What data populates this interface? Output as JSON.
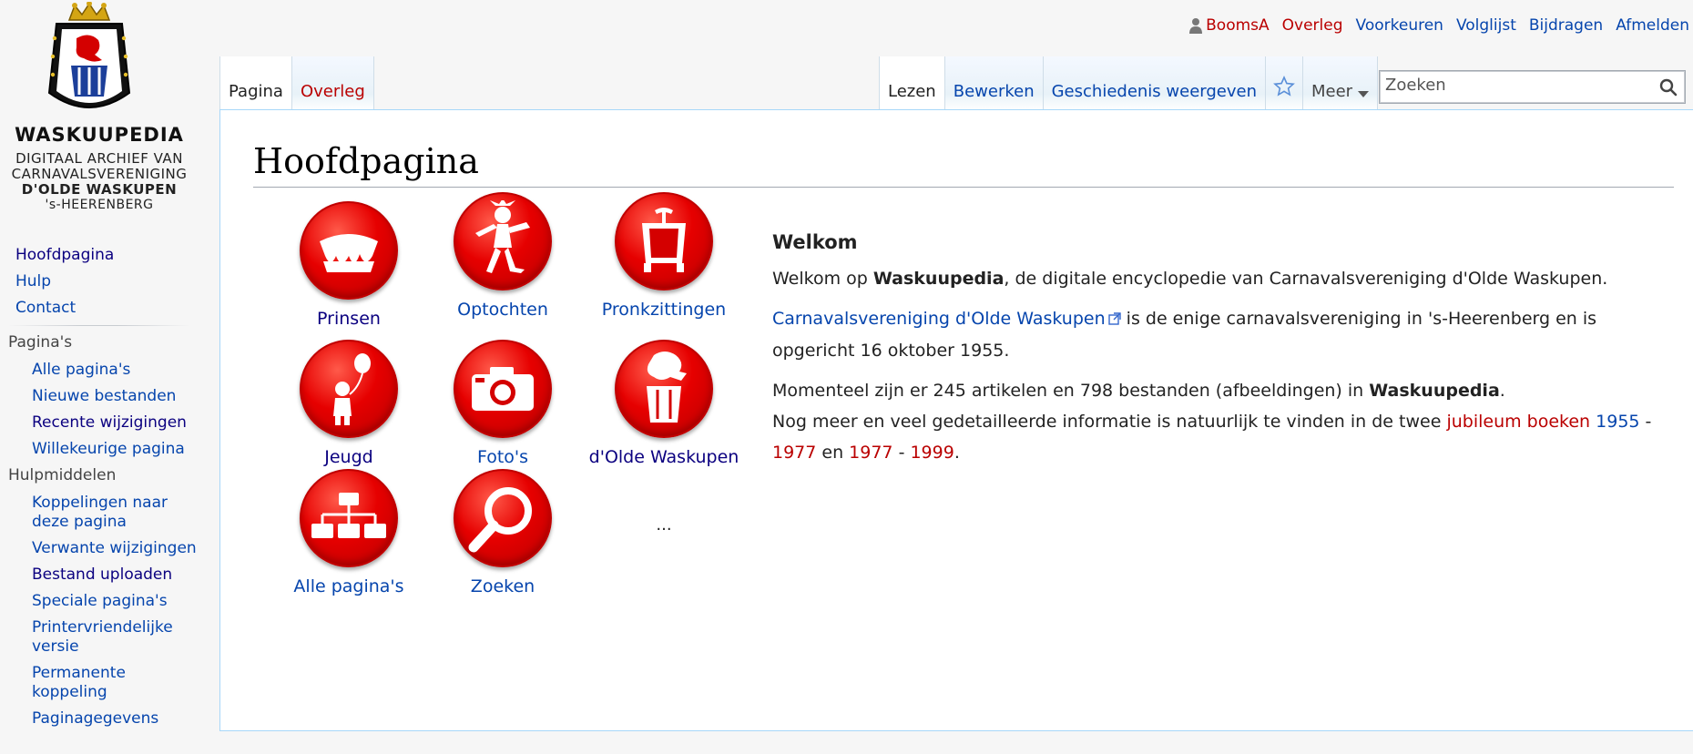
{
  "logo": {
    "title": "WASKUUPEDIA",
    "sub_line1": "DIGITAAL ARCHIEF VAN",
    "sub_line2": "CARNAVALSVERENIGING",
    "sub_line3": "D'OLDE WASKUPEN",
    "sub_line4": "'s-HEERENBERG"
  },
  "personal": {
    "user": "BoomsA",
    "talk": "Overleg",
    "preferences": "Voorkeuren",
    "watchlist": "Volglijst",
    "contributions": "Bijdragen",
    "logout": "Afmelden"
  },
  "tabs": {
    "page": "Pagina",
    "talk": "Overleg",
    "read": "Lezen",
    "edit": "Bewerken",
    "history": "Geschiedenis weergeven",
    "more": "Meer"
  },
  "search": {
    "placeholder": "Zoeken"
  },
  "sidebar": {
    "nav": [
      "Hoofdpagina",
      "Hulp",
      "Contact"
    ],
    "pages_heading": "Pagina's",
    "pages": [
      "Alle pagina's",
      "Nieuwe bestanden",
      "Recente wijzigingen",
      "Willekeurige pagina"
    ],
    "tools_heading": "Hulpmiddelen",
    "tools": [
      "Koppelingen naar deze pagina",
      "Verwante wijzigingen",
      "Bestand uploaden",
      "Speciale pagina's",
      "Printervriendelijke versie",
      "Permanente koppeling",
      "Paginagegevens"
    ]
  },
  "content": {
    "heading": "Hoofdpagina",
    "grid": {
      "prinsen": "Prinsen",
      "optochten": "Optochten",
      "pronkzittingen": "Pronkzittingen",
      "jeugd": "Jeugd",
      "fotos": "Foto's",
      "olde_waskupen": "d'Olde Waskupen",
      "alle_paginas": "Alle pagina's",
      "zoeken": "Zoeken",
      "more": "..."
    },
    "welcome": {
      "title": "Welkom",
      "p1_before": "Welkom op ",
      "p1_bold": "Waskuupedia",
      "p1_after": ", de digitale encyclopedie van Carnavalsvereniging d'Olde Waskupen.",
      "p2_link": "Carnavalsvereniging d'Olde Waskupen",
      "p2_after": " is de enige carnavalsvereniging in 's-Heerenberg en is opgericht 16 oktober 1955.",
      "p3_before": "Momenteel zijn er 245 artikelen en 798 bestanden (afbeeldingen) in ",
      "p3_bold": "Waskuupedia",
      "p3_after": ".",
      "p3_line2_before": "Nog meer en veel gedetailleerde informatie is natuurlijk te vinden in de twee ",
      "p3_link_boeken": "jubileum boeken",
      "p3_link_1955": "1955",
      "p3_dash1": " - ",
      "p3_link_1977a": "1977",
      "p3_en": " en ",
      "p3_link_1977b": "1977",
      "p3_dash2": " - ",
      "p3_link_1999": "1999",
      "p3_end": "."
    }
  },
  "colors": {
    "accent_red": "#e60000",
    "link": "#0645ad",
    "redlink": "#ba0000"
  }
}
